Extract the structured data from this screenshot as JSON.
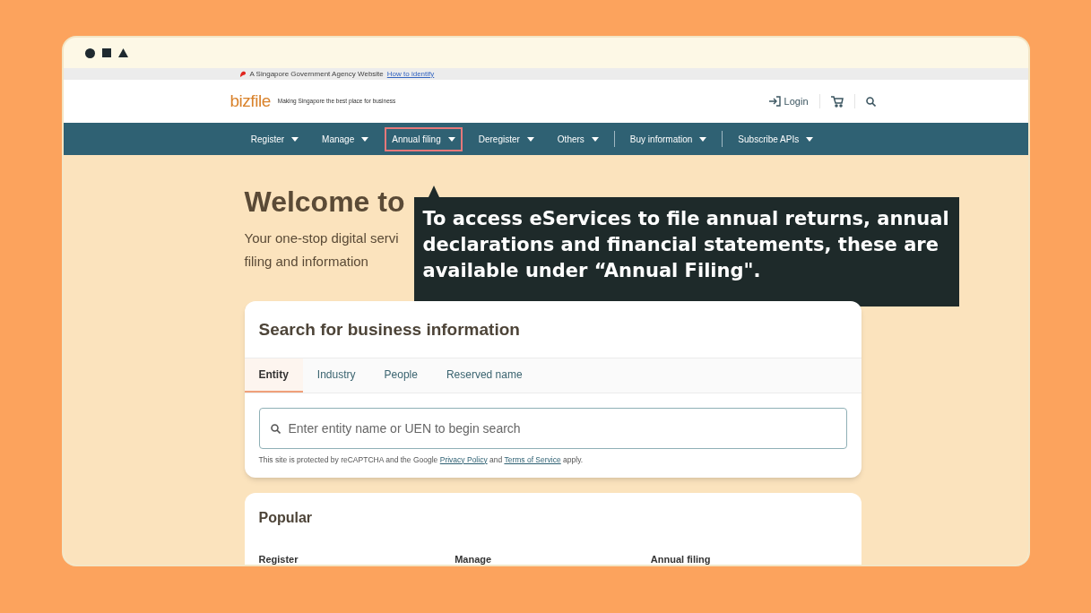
{
  "gov_banner": {
    "text": "A Singapore Government Agency Website",
    "link": "How to identify"
  },
  "header": {
    "logo": "bizfile",
    "tagline": "Making Singapore the best place for business",
    "login": "Login"
  },
  "nav": [
    {
      "label": "Register",
      "selected": false,
      "divider_before": false
    },
    {
      "label": "Manage",
      "selected": false,
      "divider_before": false
    },
    {
      "label": "Annual filing",
      "selected": true,
      "divider_before": false
    },
    {
      "label": "Deregister",
      "selected": false,
      "divider_before": false
    },
    {
      "label": "Others",
      "selected": false,
      "divider_before": false
    },
    {
      "label": "Buy information",
      "selected": false,
      "divider_before": true
    },
    {
      "label": "Subscribe APIs",
      "selected": false,
      "divider_before": true
    }
  ],
  "hero": {
    "title": "Welcome to",
    "subtitle_line_1": "Your one-stop digital servi",
    "subtitle_line_2": "filing and information"
  },
  "tooltip": {
    "text": "To access eServices to file annual returns, annual declarations and financial statements, these are available under “Annual Filing\"."
  },
  "search_card": {
    "title": "Search for business information",
    "tabs": [
      {
        "label": "Entity",
        "selected": true
      },
      {
        "label": "Industry",
        "selected": false
      },
      {
        "label": "People",
        "selected": false
      },
      {
        "label": "Reserved name",
        "selected": false
      }
    ],
    "search": {
      "placeholder": "Enter entity name or UEN to begin search"
    },
    "note": {
      "before": "This site is protected by reCAPTCHA and the Google",
      "link_1": "Privacy Policy",
      "middle": "and",
      "link_2": "Terms of Service",
      "after": "apply."
    }
  },
  "popular": {
    "title": "Popular",
    "columns": [
      "Register",
      "Manage",
      "Annual filing"
    ]
  }
}
